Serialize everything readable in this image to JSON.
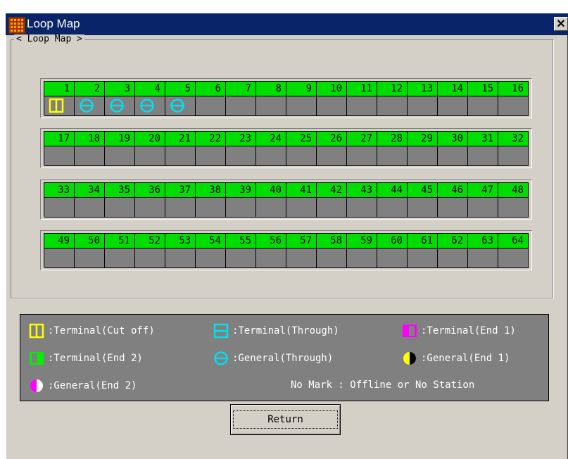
{
  "window": {
    "title": "Loop Map",
    "close_label": "✕"
  },
  "group": {
    "label": "< Loop Map >"
  },
  "rows": [
    {
      "numbers": [
        "1",
        "2",
        "3",
        "4",
        "5",
        "6",
        "7",
        "8",
        "9",
        "10",
        "11",
        "12",
        "13",
        "14",
        "15",
        "16"
      ],
      "status": [
        "terminal-cut-off",
        "general-through",
        "general-through",
        "general-through",
        "general-through",
        "",
        "",
        "",
        "",
        "",
        "",
        "",
        "",
        "",
        "",
        ""
      ]
    },
    {
      "numbers": [
        "17",
        "18",
        "19",
        "20",
        "21",
        "22",
        "23",
        "24",
        "25",
        "26",
        "27",
        "28",
        "29",
        "30",
        "31",
        "32"
      ],
      "status": [
        "",
        "",
        "",
        "",
        "",
        "",
        "",
        "",
        "",
        "",
        "",
        "",
        "",
        "",
        "",
        ""
      ]
    },
    {
      "numbers": [
        "33",
        "34",
        "35",
        "36",
        "37",
        "38",
        "39",
        "40",
        "41",
        "42",
        "43",
        "44",
        "45",
        "46",
        "47",
        "48"
      ],
      "status": [
        "",
        "",
        "",
        "",
        "",
        "",
        "",
        "",
        "",
        "",
        "",
        "",
        "",
        "",
        "",
        ""
      ]
    },
    {
      "numbers": [
        "49",
        "50",
        "51",
        "52",
        "53",
        "54",
        "55",
        "56",
        "57",
        "58",
        "59",
        "60",
        "61",
        "62",
        "63",
        "64"
      ],
      "status": [
        "",
        "",
        "",
        "",
        "",
        "",
        "",
        "",
        "",
        "",
        "",
        "",
        "",
        "",
        "",
        ""
      ]
    }
  ],
  "legend": {
    "items": [
      {
        "icon": "terminal-cut-off",
        "label": ":Terminal(Cut off)"
      },
      {
        "icon": "terminal-through",
        "label": ":Terminal(Through)"
      },
      {
        "icon": "terminal-end1",
        "label": ":Terminal(End 1)"
      },
      {
        "icon": "terminal-end2",
        "label": ":Terminal(End 2)"
      },
      {
        "icon": "general-through",
        "label": ":General(Through)"
      },
      {
        "icon": "general-end1",
        "label": ":General(End 1)"
      },
      {
        "icon": "general-end2",
        "label": ":General(End 2)"
      }
    ],
    "note": "No Mark : Offline or No Station"
  },
  "colors": {
    "yellow": "#ffff00",
    "cyan": "#00e0f0",
    "magenta": "#ff00ff",
    "green": "#00f000",
    "station_bg": "#808080"
  },
  "buttons": {
    "return_label": "Return"
  }
}
